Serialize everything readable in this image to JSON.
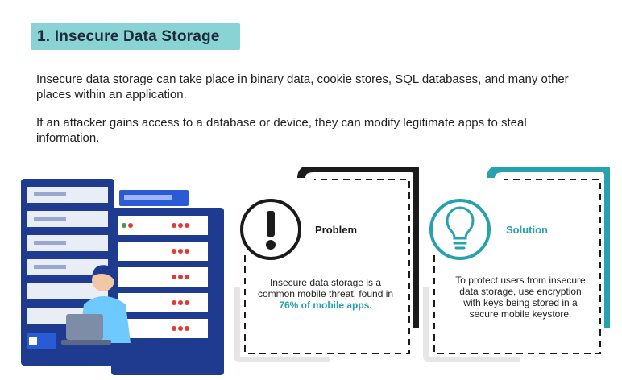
{
  "header": {
    "title": "1. Insecure Data Storage"
  },
  "paragraphs": [
    "Insecure data storage can take place in binary data, cookie stores, SQL databases, and many other places within an application.",
    "If an attacker gains access to a database or device, they can modify legitimate apps to steal information."
  ],
  "problem_card": {
    "title": "Problem",
    "text_before": "Insecure data storage is a common mobile threat, found in ",
    "highlight": "76% of mobile apps.",
    "icon": "exclamation-icon"
  },
  "solution_card": {
    "title": "Solution",
    "text": "To protect users from insecure data storage, use encryption with keys being stored in a secure mobile keystore.",
    "icon": "lightbulb-icon"
  },
  "colors": {
    "accent": "#25a2ad",
    "title_band": "#8ad3d5",
    "navy": "#1f3b8f",
    "dark": "#1b1b1b"
  }
}
